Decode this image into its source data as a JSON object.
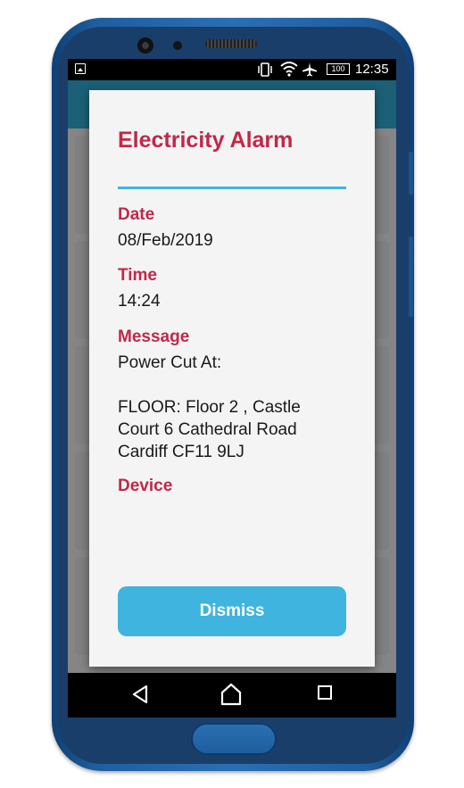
{
  "status_bar": {
    "time": "12:35",
    "battery": "100"
  },
  "dialog": {
    "title": "Electricity Alarm",
    "fields": [
      {
        "label": "Date",
        "value": "08/Feb/2019"
      },
      {
        "label": "Time",
        "value": "14:24"
      },
      {
        "label": "Message",
        "value": "Power Cut At:\n\nFLOOR: Floor 2 , Castle Court 6 Cathedral Road Cardiff CF11 9LJ"
      },
      {
        "label": "Device",
        "value": ""
      }
    ],
    "dismiss_label": "Dismiss"
  },
  "colors": {
    "accent": "#c0284a",
    "button": "#3fb4de",
    "phone": "#2a6fb3"
  },
  "icons": {
    "status": [
      "image-icon",
      "vibrate-icon",
      "wifi-icon",
      "airplane-icon",
      "battery-icon"
    ],
    "nav": [
      "back-icon",
      "home-icon",
      "recent-apps-icon"
    ]
  }
}
